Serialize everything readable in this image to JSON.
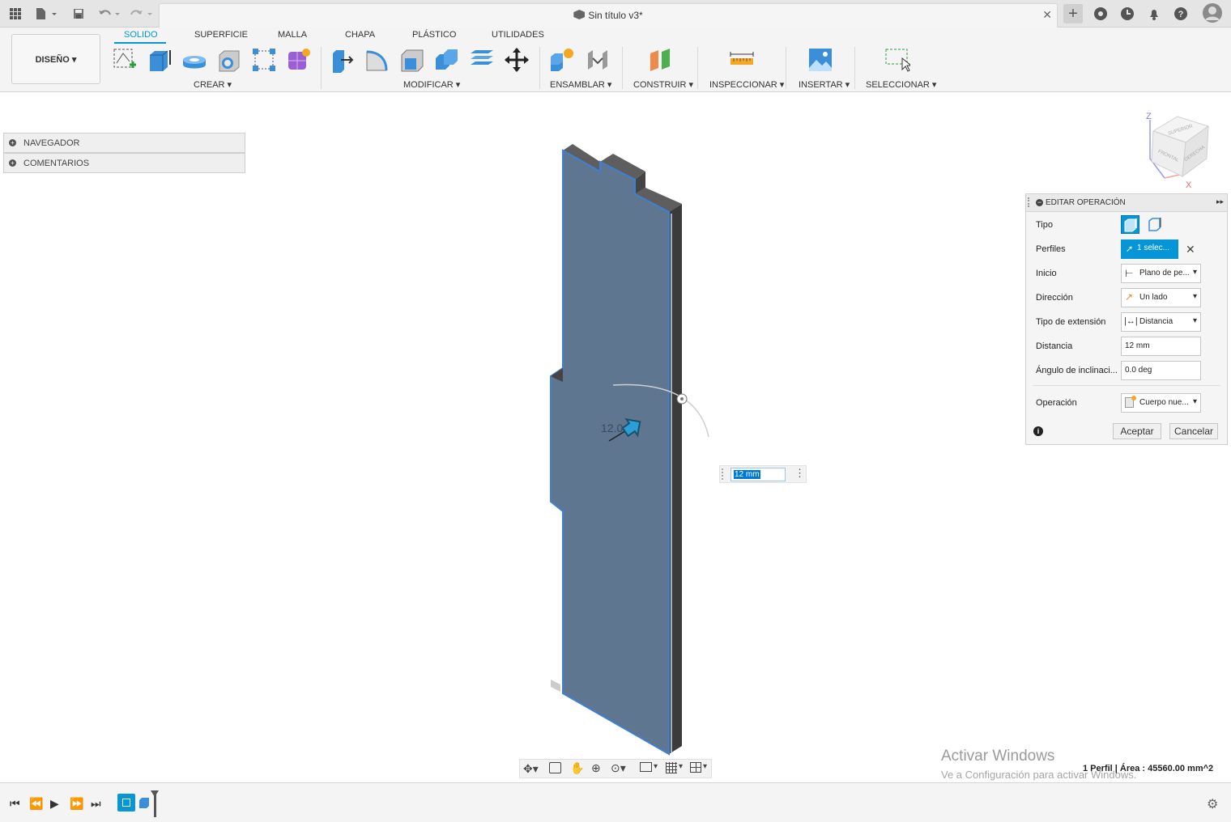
{
  "document": {
    "title": "Sin título v3*"
  },
  "workspace": {
    "label": "DISEÑO ▾"
  },
  "ribbon": {
    "tabs": [
      "SOLIDO",
      "SUPERFICIE",
      "MALLA",
      "CHAPA",
      "PLÁSTICO",
      "UTILIDADES"
    ],
    "active_tab": "SOLIDO",
    "groups": [
      "CREAR ▾",
      "MODIFICAR ▾",
      "ENSAMBLAR ▾",
      "CONSTRUIR ▾",
      "INSPECCIONAR ▾",
      "INSERTAR ▾",
      "SELECCIONAR ▾"
    ]
  },
  "browser": {
    "navigator": "NAVEGADOR",
    "comments": "COMENTARIOS"
  },
  "viewcube": {
    "z": "Z",
    "x": "X",
    "top": "SUPERIOR",
    "front": "FRONTAL",
    "right": "DERECHA"
  },
  "dialog": {
    "title": "EDITAR OPERACIÓN",
    "rows": {
      "tipo": "Tipo",
      "perfiles": "Perfiles",
      "perfiles_value": "1 selec...",
      "inicio": "Inicio",
      "inicio_value": "Plano de pe...",
      "direccion": "Dirección",
      "direccion_value": "Un lado",
      "tipo_ext": "Tipo de extensión",
      "tipo_ext_value": "Distancia",
      "distancia": "Distancia",
      "distancia_value": "12 mm",
      "angulo": "Ángulo de inclinaci...",
      "angulo_value": "0.0 deg",
      "operacion": "Operación",
      "operacion_value": "Cuerpo nue..."
    },
    "ok": "Aceptar",
    "cancel": "Cancelar"
  },
  "canvas": {
    "manip_label": "12.0",
    "input_value": "12 mm"
  },
  "status": {
    "watermark_title": "Activar Windows",
    "watermark_sub": "Ve a Configuración para activar Windows.",
    "info": "1 Perfil | Área : 45560.00 mm^2"
  },
  "colors": {
    "accent": "#0696d7",
    "body_face": "#5e7690",
    "body_edge": "#3d3d3d"
  }
}
